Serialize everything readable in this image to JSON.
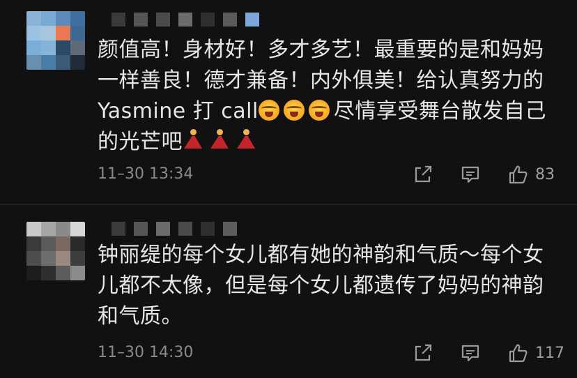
{
  "comments": [
    {
      "avatar_colors": [
        "#8ab4d8",
        "#7aa9d4",
        "#5d8ab8",
        "#3f6fa0",
        "#9cc4e2",
        "#a6c6dd",
        "#e77a55",
        "#3d6a92",
        "#7aaed6",
        "#86b4d8",
        "#2a4a6a",
        "#5e6a78",
        "#6a8fae",
        "#4a7ea8",
        "#3a5a78",
        "#1f2b36"
      ],
      "username_colors": [
        "#3a3a3a",
        "#555555",
        "#4a4a4a",
        "#6b6b6b",
        "#2f2f2f",
        "#5a5a5a",
        "#7fa6d9"
      ],
      "content_lines": [
        "颜值高！身材好！多才多艺！最重要的是和妈妈",
        "一样善良！德才兼备！内外俱美！给认真努力的"
      ],
      "line3_before": "Yasmine 打 call",
      "line3_after": "尽情享受舞台散发自己",
      "line4": "的光芒吧",
      "emoji_cry": "crying-face-emoji",
      "emoji_dancer": "dancer-emoji",
      "time": "11–30 13:34",
      "like_count": "83"
    },
    {
      "avatar_colors": [
        "#c9c9c9",
        "#a6a6a6",
        "#8a8a8a",
        "#d6d6d6",
        "#3a3a3a",
        "#5a5a5a",
        "#7a6a62",
        "#2a2a2a",
        "#4d4d4d",
        "#6e6e6e",
        "#9a8a80",
        "#3d3d3d",
        "#1c1c1c",
        "#2e2e2e",
        "#5c5c5c",
        "#8c8c8c"
      ],
      "username_colors": [
        "#3a3a3a",
        "#555555",
        "#6b6b6b",
        "#4a4a4a",
        "#303030",
        "#5d5d5d"
      ],
      "content_lines": [
        "钟丽缇的每个女儿都有她的神韵和气质～每个女",
        "儿都不太像，但是每个女儿都遗传了妈妈的神韵",
        "和气质。"
      ],
      "time": "11–30 14:30",
      "like_count": "117"
    }
  ],
  "icons": {
    "share": "share-icon",
    "reply": "reply-icon",
    "like": "thumbs-up-icon"
  }
}
